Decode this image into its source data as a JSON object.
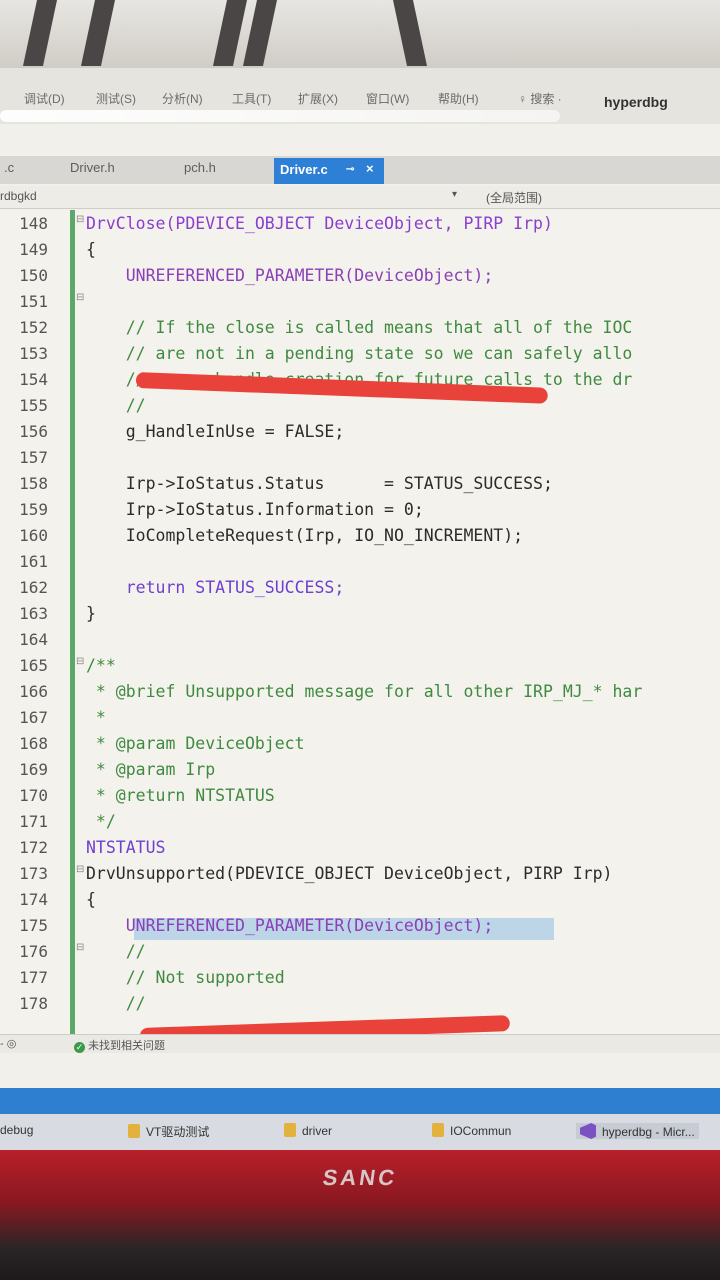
{
  "menubar": {
    "items": [
      "调试(D)",
      "测试(S)",
      "分析(N)",
      "工具(T)",
      "扩展(X)",
      "窗口(W)",
      "帮助(H)"
    ],
    "search_label": "♀ 搜索 ·",
    "app_title": "hyperdbg"
  },
  "tabs": [
    {
      "label": ".c"
    },
    {
      "label": "Driver.h"
    },
    {
      "label": "pch.h"
    },
    {
      "label": "Driver.c",
      "active": true,
      "pin": "⊸",
      "close": "×"
    }
  ],
  "navbar": {
    "project": "rdbgkd",
    "dropdown_icon": "▾",
    "scope": "(全局范围)"
  },
  "code_lines": [
    {
      "n": "148",
      "text": "DrvClose(PDEVICE_OBJECT DeviceObject, PIRP Irp)"
    },
    {
      "n": "149",
      "text": "{"
    },
    {
      "n": "150",
      "text": "    UNREFERENCED_PARAMETER(DeviceObject);"
    },
    {
      "n": "151",
      "text": "    "
    },
    {
      "n": "152",
      "text": "    // If the close is called means that all of the IOC"
    },
    {
      "n": "153",
      "text": "    // are not in a pending state so we can safely allo"
    },
    {
      "n": "154",
      "text": "    // a new handle creation for future calls to the dr"
    },
    {
      "n": "155",
      "text": "    //"
    },
    {
      "n": "156",
      "text": "    g_HandleInUse = FALSE;"
    },
    {
      "n": "157",
      "text": ""
    },
    {
      "n": "158",
      "text": "    Irp->IoStatus.Status      = STATUS_SUCCESS;"
    },
    {
      "n": "159",
      "text": "    Irp->IoStatus.Information = 0;"
    },
    {
      "n": "160",
      "text": "    IoCompleteRequest(Irp, IO_NO_INCREMENT);"
    },
    {
      "n": "161",
      "text": ""
    },
    {
      "n": "162",
      "text": "    return STATUS_SUCCESS;"
    },
    {
      "n": "163",
      "text": "}"
    },
    {
      "n": "164",
      "text": ""
    },
    {
      "n": "165",
      "text": "/**"
    },
    {
      "n": "166",
      "text": " * @brief Unsupported message for all other IRP_MJ_* har"
    },
    {
      "n": "167",
      "text": " *"
    },
    {
      "n": "168",
      "text": " * @param DeviceObject"
    },
    {
      "n": "169",
      "text": " * @param Irp"
    },
    {
      "n": "170",
      "text": " * @return NTSTATUS"
    },
    {
      "n": "171",
      "text": " */"
    },
    {
      "n": "172",
      "text": "NTSTATUS"
    },
    {
      "n": "173",
      "text": "DrvUnsupported(PDEVICE_OBJECT DeviceObject, PIRP Irp)"
    },
    {
      "n": "174",
      "text": "{"
    },
    {
      "n": "175",
      "text": "    UNREFERENCED_PARAMETER(DeviceObject);"
    },
    {
      "n": "176",
      "text": "    //"
    },
    {
      "n": "177",
      "text": "    // Not supported"
    },
    {
      "n": "178",
      "text": "    //"
    }
  ],
  "statusbar": {
    "zoom": "- ◎",
    "ok_icon": "✓",
    "message": "未找到相关问题"
  },
  "taskbar": {
    "items": [
      "debug",
      "VT驱动测试",
      "driver",
      "IOCommun",
      "hyperdbg - Micr..."
    ]
  },
  "monitor_brand": "SANC",
  "colors": {
    "accent": "#2e7fd6",
    "change_bar": "#5aa86a",
    "redaction": "#e8423a",
    "bezel": "#b8202a"
  }
}
